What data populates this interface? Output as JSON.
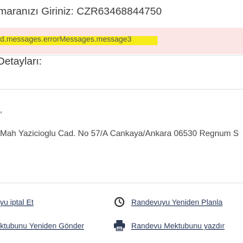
{
  "header": {
    "order_label": "maranızı Giriniz: CZR63468844750"
  },
  "error_banner": {
    "message": "d.messages.errorMessages.message3"
  },
  "details": {
    "title": "Detayları:",
    "bullet": ",",
    "address": "Mah Yazicioglu Cad. No 57/A Cankaya/Ankara 06530 Regnum S"
  },
  "actions": {
    "cancel": "yu iptal Et",
    "reschedule": "Randevuyu Yeniden Planla",
    "resend": "ktubunu Yeniden Gönder",
    "print": "Randevu Mektubunu yazdır"
  },
  "colors": {
    "error_bg": "#fbe5e5",
    "highlight": "#f7ec1a",
    "link": "#2a3a5c"
  },
  "icons": {
    "reschedule": "clock-icon",
    "print": "printer-icon"
  }
}
